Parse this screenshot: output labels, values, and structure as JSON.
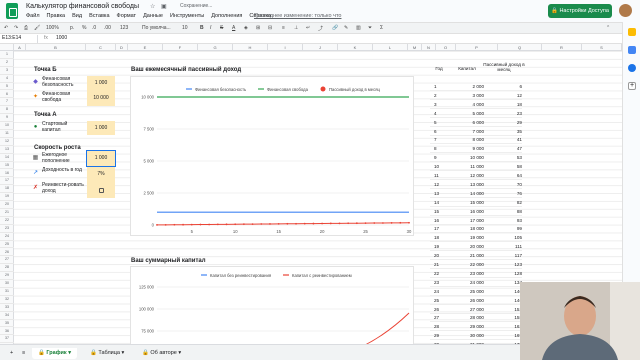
{
  "app": {
    "title": "Калькулятор финансовой свободы",
    "saving": "Сохранение...",
    "last_edit": "Последнее изменение: только что",
    "access_button": "Настройки Доступа"
  },
  "menu": [
    "Файл",
    "Правка",
    "Вид",
    "Вставка",
    "Формат",
    "Данные",
    "Инструменты",
    "Дополнения",
    "Справка"
  ],
  "toolbar": {
    "zoom": "100%",
    "currency": "р.",
    "percent": "%",
    "decimals": ".0",
    "dec2": ".00",
    "numfmt": "123",
    "font": "По умолча...",
    "size": "10"
  },
  "formula": {
    "cell": "E13:E14",
    "fx": "fx",
    "value": "1000"
  },
  "columns": [
    "A",
    "B",
    "C",
    "D",
    "E",
    "F",
    "G",
    "H",
    "I",
    "J",
    "K",
    "L",
    "M",
    "N",
    "O",
    "P",
    "Q",
    "R",
    "S",
    "T"
  ],
  "rows": [
    "1",
    "2",
    "3",
    "4",
    "5",
    "6",
    "7",
    "8",
    "9",
    "10",
    "11",
    "12",
    "13",
    "14",
    "15",
    "16",
    "17",
    "18",
    "19",
    "20",
    "21",
    "22",
    "23",
    "24",
    "25",
    "26",
    "27",
    "28",
    "29",
    "30",
    "31",
    "32",
    "33",
    "34",
    "35",
    "36",
    "37"
  ],
  "left": {
    "pointB": "Точка Б",
    "fin_safety": "Финансовая безопасность",
    "fin_safety_val": "1 000",
    "fin_freedom": "Финансовая свобода",
    "fin_freedom_val": "10 000",
    "pointA": "Точка А",
    "start_capital": "Стартовый капитал",
    "start_capital_val": "1 000",
    "growth": "Скорость роста",
    "monthly": "Ежегодное пополнение",
    "monthly_val": "1 000",
    "yield": "Доходность в год",
    "yield_val": "7%",
    "reinvest": "Реинвести-ровать доход"
  },
  "chart1": {
    "title": "Ваш ежемесячный пассивный доход",
    "legend": [
      "Финансовая безопасность",
      "Финансовая свобода",
      "Пассивный доход в месяц"
    ],
    "yticks": [
      "10 000",
      "7 500",
      "5 000",
      "2 500",
      "0"
    ],
    "xticks": [
      "5",
      "10",
      "15",
      "20",
      "25",
      "30"
    ]
  },
  "chart2": {
    "title": "Ваш суммарный капитал",
    "legend": [
      "Капитал без реинвестирования",
      "Капитал с реинвестированием"
    ],
    "yticks": [
      "125 000",
      "100 000",
      "75 000"
    ]
  },
  "table": {
    "headers": [
      "Год",
      "Капитал",
      "Пассивный доход в месяц"
    ],
    "rows": [
      [
        "1",
        "2 000",
        "6"
      ],
      [
        "2",
        "3 000",
        "12"
      ],
      [
        "3",
        "4 000",
        "18"
      ],
      [
        "4",
        "5 000",
        "23"
      ],
      [
        "5",
        "6 000",
        "29"
      ],
      [
        "6",
        "7 000",
        "35"
      ],
      [
        "7",
        "8 000",
        "41"
      ],
      [
        "8",
        "9 000",
        "47"
      ],
      [
        "9",
        "10 000",
        "53"
      ],
      [
        "10",
        "11 000",
        "58"
      ],
      [
        "11",
        "12 000",
        "64"
      ],
      [
        "12",
        "13 000",
        "70"
      ],
      [
        "13",
        "14 000",
        "76"
      ],
      [
        "14",
        "15 000",
        "82"
      ],
      [
        "15",
        "16 000",
        "88"
      ],
      [
        "16",
        "17 000",
        "93"
      ],
      [
        "17",
        "18 000",
        "99"
      ],
      [
        "18",
        "19 000",
        "105"
      ],
      [
        "19",
        "20 000",
        "111"
      ],
      [
        "20",
        "21 000",
        "117"
      ],
      [
        "21",
        "22 000",
        "123"
      ],
      [
        "22",
        "23 000",
        "128"
      ],
      [
        "23",
        "24 000",
        "134"
      ],
      [
        "24",
        "25 000",
        "140"
      ],
      [
        "25",
        "26 000",
        "146"
      ],
      [
        "26",
        "27 000",
        "152"
      ],
      [
        "27",
        "28 000",
        "158"
      ],
      [
        "28",
        "29 000",
        "163"
      ],
      [
        "29",
        "30 000",
        "169"
      ],
      [
        "30",
        "31 000",
        "175"
      ]
    ]
  },
  "sheets": [
    "График",
    "Таблица",
    "Об авторе"
  ],
  "colors": {
    "blue": "#4285f4",
    "green": "#34a853",
    "red": "#ea4335",
    "accent": "#1a8b4c"
  }
}
